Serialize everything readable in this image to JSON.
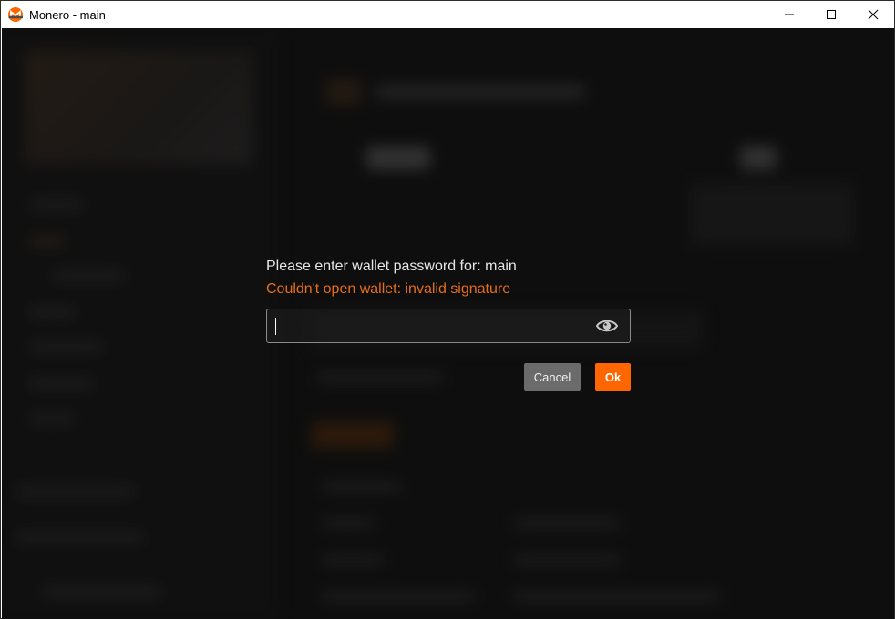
{
  "window": {
    "title": "Monero - main",
    "icon": "monero-logo-icon",
    "controls": [
      "minimize-icon",
      "maximize-icon",
      "close-icon"
    ]
  },
  "dialog": {
    "prompt": "Please enter wallet password for: main",
    "error": "Couldn't open wallet: invalid signature",
    "password_value": "",
    "visibility_icon": "eye-icon",
    "cancel_label": "Cancel",
    "ok_label": "Ok"
  },
  "colors": {
    "background": "#161616",
    "accent": "#ff6600",
    "error_text": "#e66d1a",
    "cancel_button": "#6b6b6b"
  }
}
